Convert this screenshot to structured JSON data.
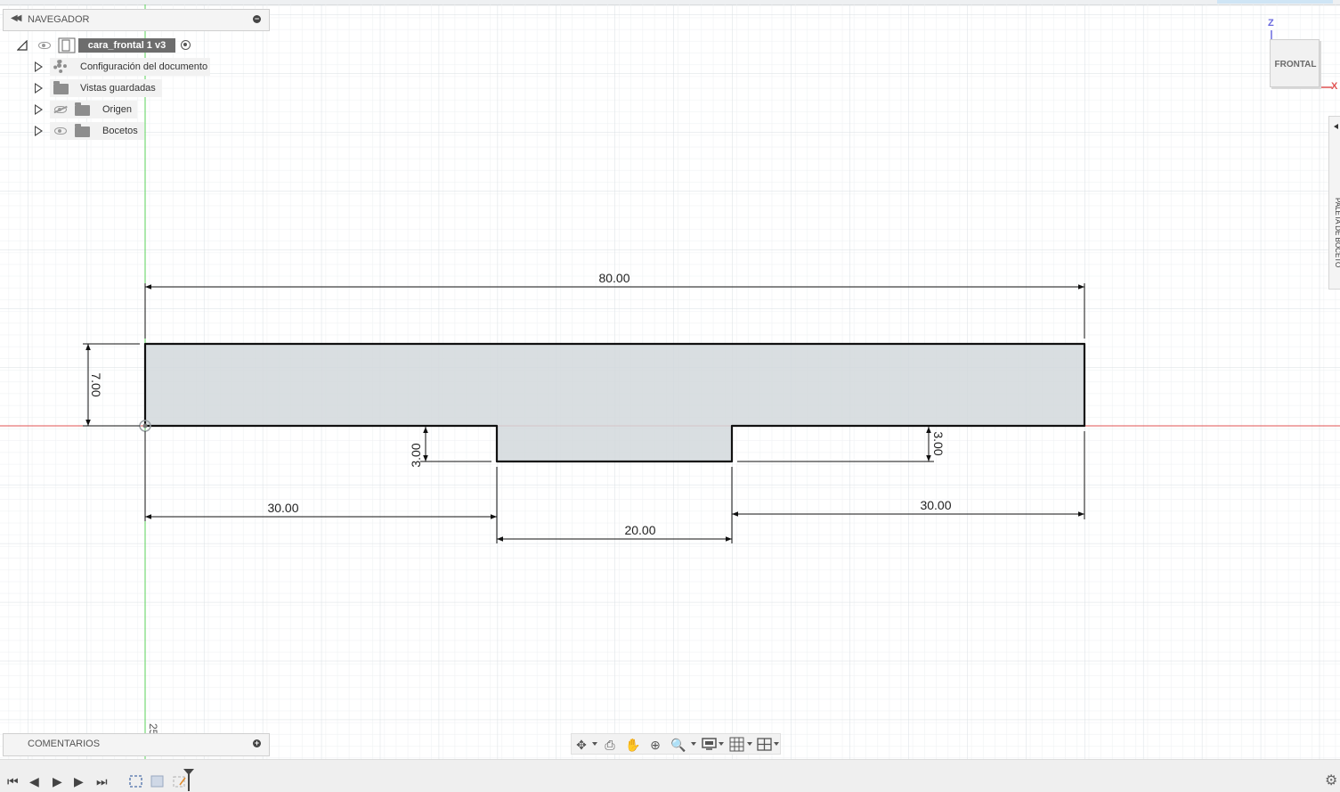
{
  "browser": {
    "title": "NAVEGADOR",
    "root": "cara_frontal 1 v3",
    "items": [
      {
        "label": "Configuración del documento",
        "icon": "gear-icon"
      },
      {
        "label": "Vistas guardadas",
        "icon": "folder-icon"
      },
      {
        "label": "Origen",
        "icon": "folder-icon",
        "visibility": "hidden"
      },
      {
        "label": "Bocetos",
        "icon": "folder-icon",
        "visibility": "visible"
      }
    ]
  },
  "comments": {
    "title": "COMENTARIOS"
  },
  "viewcube": {
    "face_label": "FRONTAL",
    "axis_z": "Z",
    "axis_x": "X"
  },
  "right_palette": {
    "label": "PALETA DE BOCETO"
  },
  "sketch": {
    "dimensions": {
      "total_width": "80.00",
      "height": "7.00",
      "left_segment": "30.00",
      "middle_segment": "20.00",
      "right_segment": "30.00",
      "left_step": "3.00",
      "right_step": "3.00"
    },
    "ruler_label": "25"
  },
  "navbar": {
    "icons": [
      "orbit-icon",
      "look-at-icon",
      "pan-icon",
      "zoom-icon",
      "fit-icon",
      "display-settings-icon",
      "grid-icon",
      "viewports-icon"
    ]
  },
  "colors": {
    "profile_fill": "#d2d8dc",
    "x_axis": "#e05353",
    "z_axis": "#5ad15a",
    "grid": "#e4e9ec",
    "dimension": "#111111"
  }
}
